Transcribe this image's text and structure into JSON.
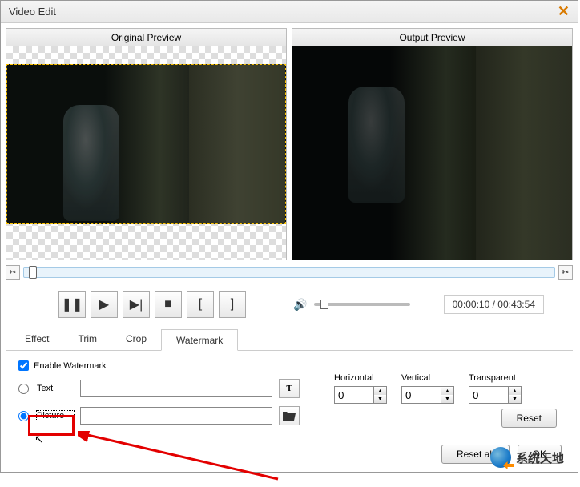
{
  "window": {
    "title": "Video Edit"
  },
  "preview": {
    "original_label": "Original Preview",
    "output_label": "Output Preview"
  },
  "playback": {
    "timecode": "00:00:10 / 00:43:54"
  },
  "tabs": {
    "items": [
      {
        "label": "Effect"
      },
      {
        "label": "Trim"
      },
      {
        "label": "Crop"
      },
      {
        "label": "Watermark"
      }
    ],
    "active": 3
  },
  "watermark": {
    "enable_label": "Enable Watermark",
    "text_label": "Text",
    "picture_label": "Picture",
    "text_value": "",
    "picture_value": "",
    "text_btn_glyph": "T"
  },
  "fields": {
    "horizontal": {
      "label": "Horizontal",
      "value": "0"
    },
    "vertical": {
      "label": "Vertical",
      "value": "0"
    },
    "transparent": {
      "label": "Transparent",
      "value": "0"
    }
  },
  "buttons": {
    "reset": "Reset",
    "reset_all": "Reset all",
    "ok": "OK"
  },
  "brand": "系统天地"
}
